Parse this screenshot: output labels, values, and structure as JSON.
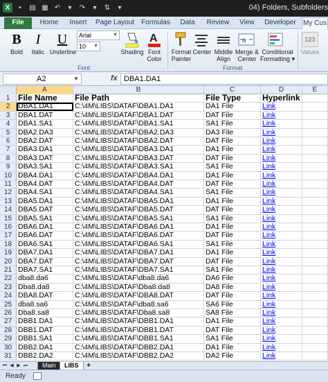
{
  "window": {
    "title": "04) Folders, Subfolders"
  },
  "tabs": [
    "File",
    "Home",
    "Insert",
    "Page Layout",
    "Formulas",
    "Data",
    "Review",
    "View",
    "Developer",
    "My Cus"
  ],
  "ribbon": {
    "bold": "Bold",
    "italic": "Italic",
    "underline": "Underline",
    "font_name": "Arial",
    "font_size": "10",
    "shading": "Shading",
    "font_color": "Font Color",
    "font_group": "Font",
    "format_painter": "Format Painter",
    "center": "Center",
    "middle_align": "Middle Align",
    "merge_center": "Merge & Center",
    "conditional": "Conditional Formatting",
    "format_group": "Format",
    "values": "Values",
    "values_number": "123"
  },
  "formula": {
    "name_box": "A2",
    "fx": "fx",
    "content": "DBA1.DA1"
  },
  "columns": [
    "A",
    "B",
    "C",
    "D",
    "E"
  ],
  "header": {
    "a": "File Name",
    "b": "File Path",
    "c": "File Type",
    "d": "Hyperlink"
  },
  "rows": [
    {
      "n": "2",
      "a": "DBA1.DA1",
      "b": "C:\\4M\\LIBS\\DATAF\\DBA1.DA1",
      "c": "DA1 File",
      "d": "Link"
    },
    {
      "n": "3",
      "a": "DBA1.DAT",
      "b": "C:\\4M\\LIBS\\DATAF\\DBA1.DAT",
      "c": "DAT File",
      "d": "Link"
    },
    {
      "n": "4",
      "a": "DBA1.SA1",
      "b": "C:\\4M\\LIBS\\DATAF\\DBA1.SA1",
      "c": "SA1 File",
      "d": "Link"
    },
    {
      "n": "5",
      "a": "DBA2.DA3",
      "b": "C:\\4M\\LIBS\\DATAF\\DBA2.DA3",
      "c": "DA3 File",
      "d": "Link"
    },
    {
      "n": "6",
      "a": "DBA2.DAT",
      "b": "C:\\4M\\LIBS\\DATAF\\DBA2.DAT",
      "c": "DAT File",
      "d": "Link"
    },
    {
      "n": "7",
      "a": "DBA3.DA1",
      "b": "C:\\4M\\LIBS\\DATAF\\DBA3.DA1",
      "c": "DA1 File",
      "d": "Link"
    },
    {
      "n": "8",
      "a": "DBA3.DAT",
      "b": "C:\\4M\\LIBS\\DATAF\\DBA3.DAT",
      "c": "DAT File",
      "d": "Link"
    },
    {
      "n": "9",
      "a": "DBA3.SA1",
      "b": "C:\\4M\\LIBS\\DATAF\\DBA3.SA1",
      "c": "SA1 File",
      "d": "Link"
    },
    {
      "n": "10",
      "a": "DBA4.DA1",
      "b": "C:\\4M\\LIBS\\DATAF\\DBA4.DA1",
      "c": "DA1 File",
      "d": "Link"
    },
    {
      "n": "11",
      "a": "DBA4.DAT",
      "b": "C:\\4M\\LIBS\\DATAF\\DBA4.DAT",
      "c": "DAT File",
      "d": "Link"
    },
    {
      "n": "12",
      "a": "DBA4.SA1",
      "b": "C:\\4M\\LIBS\\DATAF\\DBA4.SA1",
      "c": "SA1 File",
      "d": "Link"
    },
    {
      "n": "13",
      "a": "DBA5.DA1",
      "b": "C:\\4M\\LIBS\\DATAF\\DBA5.DA1",
      "c": "DA1 File",
      "d": "Link"
    },
    {
      "n": "14",
      "a": "DBA5.DAT",
      "b": "C:\\4M\\LIBS\\DATAF\\DBA5.DAT",
      "c": "DAT File",
      "d": "Link"
    },
    {
      "n": "15",
      "a": "DBA5.SA1",
      "b": "C:\\4M\\LIBS\\DATAF\\DBA5.SA1",
      "c": "SA1 File",
      "d": "Link"
    },
    {
      "n": "16",
      "a": "DBA6.DA1",
      "b": "C:\\4M\\LIBS\\DATAF\\DBA6.DA1",
      "c": "DA1 File",
      "d": "Link"
    },
    {
      "n": "17",
      "a": "DBA6.DAT",
      "b": "C:\\4M\\LIBS\\DATAF\\DBA6.DAT",
      "c": "DAT File",
      "d": "Link"
    },
    {
      "n": "18",
      "a": "DBA6.SA1",
      "b": "C:\\4M\\LIBS\\DATAF\\DBA6.SA1",
      "c": "SA1 File",
      "d": "Link"
    },
    {
      "n": "19",
      "a": "DBA7.DA1",
      "b": "C:\\4M\\LIBS\\DATAF\\DBA7.DA1",
      "c": "DA1 File",
      "d": "Link"
    },
    {
      "n": "20",
      "a": "DBA7.DAT",
      "b": "C:\\4M\\LIBS\\DATAF\\DBA7.DAT",
      "c": "DAT File",
      "d": "Link"
    },
    {
      "n": "21",
      "a": "DBA7.SA1",
      "b": "C:\\4M\\LIBS\\DATAF\\DBA7.SA1",
      "c": "SA1 File",
      "d": "Link"
    },
    {
      "n": "22",
      "a": "dba8.da6",
      "b": "C:\\4M\\LIBS\\DATAF\\dba8.da6",
      "c": "DA6 File",
      "d": "Link"
    },
    {
      "n": "23",
      "a": "Dba8.da8",
      "b": "C:\\4M\\LIBS\\DATAF\\Dba8.da8",
      "c": "DA8 File",
      "d": "Link"
    },
    {
      "n": "24",
      "a": "DBA8.DAT",
      "b": "C:\\4M\\LIBS\\DATAF\\DBA8.DAT",
      "c": "DAT File",
      "d": "Link"
    },
    {
      "n": "25",
      "a": "dba8.sa6",
      "b": "C:\\4M\\LIBS\\DATAF\\dba8.sa6",
      "c": "SA6 File",
      "d": "Link"
    },
    {
      "n": "26",
      "a": "Dba8.sa8",
      "b": "C:\\4M\\LIBS\\DATAF\\Dba8.sa8",
      "c": "SA8 File",
      "d": "Link"
    },
    {
      "n": "27",
      "a": "DBB1.DA1",
      "b": "C:\\4M\\LIBS\\DATAF\\DBB1.DA1",
      "c": "DA1 File",
      "d": "Link"
    },
    {
      "n": "28",
      "a": "DBB1.DAT",
      "b": "C:\\4M\\LIBS\\DATAF\\DBB1.DAT",
      "c": "DAT File",
      "d": "Link"
    },
    {
      "n": "29",
      "a": "DBB1.SA1",
      "b": "C:\\4M\\LIBS\\DATAF\\DBB1.SA1",
      "c": "SA1 File",
      "d": "Link"
    },
    {
      "n": "30",
      "a": "DBB2.DA1",
      "b": "C:\\4M\\LIBS\\DATAF\\DBB2.DA1",
      "c": "DA1 File",
      "d": "Link"
    },
    {
      "n": "31",
      "a": "DBB2.DA2",
      "b": "C:\\4M\\LIBS\\DATAF\\DBB2.DA2",
      "c": "DA2 File",
      "d": "Link"
    }
  ],
  "sheets": [
    "Main",
    "LIBS"
  ],
  "status": {
    "text": "Ready"
  },
  "colors": {
    "file_tab": "#2f7a3e",
    "link": "#0000ee",
    "ribbon": "#dfe8f3"
  }
}
